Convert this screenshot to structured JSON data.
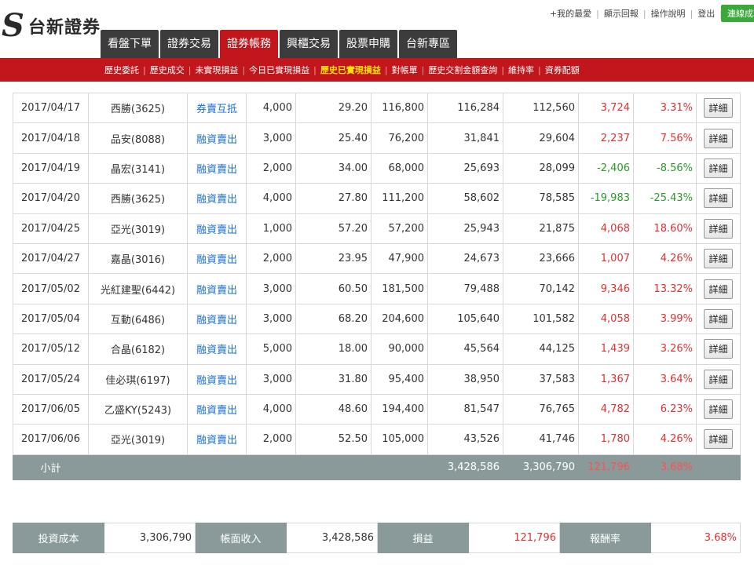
{
  "header": {
    "logo_text": "台新證券",
    "top_links": [
      "+我的最愛",
      "顯示回報",
      "操作說明",
      "登出"
    ],
    "login_button": "連線成功"
  },
  "main_tabs": [
    {
      "label": "看盤下單",
      "active": false
    },
    {
      "label": "證券交易",
      "active": false
    },
    {
      "label": "證券帳務",
      "active": true
    },
    {
      "label": "興櫃交易",
      "active": false
    },
    {
      "label": "股票申購",
      "active": false
    },
    {
      "label": "台新專區",
      "active": false
    }
  ],
  "sub_nav": [
    {
      "label": "歷史委託",
      "active": false
    },
    {
      "label": "歷史成交",
      "active": false
    },
    {
      "label": "未實現損益",
      "active": false
    },
    {
      "label": "今日已實現損益",
      "active": false
    },
    {
      "label": "歷史已實現損益",
      "active": true
    },
    {
      "label": "對帳單",
      "active": false
    },
    {
      "label": "歷史交割金額查詢",
      "active": false
    },
    {
      "label": "維持率",
      "active": false
    },
    {
      "label": "資券配額",
      "active": false
    }
  ],
  "detail_label": "詳細",
  "rows": [
    {
      "date": "2017/04/17",
      "stock": "西勝(3625)",
      "type": "券賣互抵",
      "qty": "4,000",
      "price": "29.20",
      "amount": "116,800",
      "income": "116,284",
      "cost": "112,560",
      "pnl": "3,724",
      "rate": "3.31%",
      "sign": "pos"
    },
    {
      "date": "2017/04/18",
      "stock": "品安(8088)",
      "type": "融資賣出",
      "qty": "3,000",
      "price": "25.40",
      "amount": "76,200",
      "income": "31,841",
      "cost": "29,604",
      "pnl": "2,237",
      "rate": "7.56%",
      "sign": "pos"
    },
    {
      "date": "2017/04/19",
      "stock": "晶宏(3141)",
      "type": "融資賣出",
      "qty": "2,000",
      "price": "34.00",
      "amount": "68,000",
      "income": "25,693",
      "cost": "28,099",
      "pnl": "-2,406",
      "rate": "-8.56%",
      "sign": "neg"
    },
    {
      "date": "2017/04/20",
      "stock": "西勝(3625)",
      "type": "融資賣出",
      "qty": "4,000",
      "price": "27.80",
      "amount": "111,200",
      "income": "58,602",
      "cost": "78,585",
      "pnl": "-19,983",
      "rate": "-25.43%",
      "sign": "neg"
    },
    {
      "date": "2017/04/25",
      "stock": "亞光(3019)",
      "type": "融資賣出",
      "qty": "1,000",
      "price": "57.20",
      "amount": "57,200",
      "income": "25,943",
      "cost": "21,875",
      "pnl": "4,068",
      "rate": "18.60%",
      "sign": "pos"
    },
    {
      "date": "2017/04/27",
      "stock": "嘉晶(3016)",
      "type": "融資賣出",
      "qty": "2,000",
      "price": "23.95",
      "amount": "47,900",
      "income": "24,673",
      "cost": "23,666",
      "pnl": "1,007",
      "rate": "4.26%",
      "sign": "pos"
    },
    {
      "date": "2017/05/02",
      "stock": "光紅建聖(6442)",
      "type": "融資賣出",
      "qty": "3,000",
      "price": "60.50",
      "amount": "181,500",
      "income": "79,488",
      "cost": "70,142",
      "pnl": "9,346",
      "rate": "13.32%",
      "sign": "pos"
    },
    {
      "date": "2017/05/04",
      "stock": "互動(6486)",
      "type": "融資賣出",
      "qty": "3,000",
      "price": "68.20",
      "amount": "204,600",
      "income": "105,640",
      "cost": "101,582",
      "pnl": "4,058",
      "rate": "3.99%",
      "sign": "pos"
    },
    {
      "date": "2017/05/12",
      "stock": "合晶(6182)",
      "type": "融資賣出",
      "qty": "5,000",
      "price": "18.00",
      "amount": "90,000",
      "income": "45,564",
      "cost": "44,125",
      "pnl": "1,439",
      "rate": "3.26%",
      "sign": "pos"
    },
    {
      "date": "2017/05/24",
      "stock": "佳必琪(6197)",
      "type": "融資賣出",
      "qty": "3,000",
      "price": "31.80",
      "amount": "95,400",
      "income": "38,950",
      "cost": "37,583",
      "pnl": "1,367",
      "rate": "3.64%",
      "sign": "pos"
    },
    {
      "date": "2017/06/05",
      "stock": "乙盛KY(5243)",
      "type": "融資賣出",
      "qty": "4,000",
      "price": "48.60",
      "amount": "194,400",
      "income": "81,547",
      "cost": "76,765",
      "pnl": "4,782",
      "rate": "6.23%",
      "sign": "pos"
    },
    {
      "date": "2017/06/06",
      "stock": "亞光(3019)",
      "type": "融資賣出",
      "qty": "2,000",
      "price": "52.50",
      "amount": "105,000",
      "income": "43,526",
      "cost": "41,746",
      "pnl": "1,780",
      "rate": "4.26%",
      "sign": "pos"
    }
  ],
  "subtotal": {
    "label": "小計",
    "income": "3,428,586",
    "cost": "3,306,790",
    "pnl": "121,796",
    "rate": "3.68%"
  },
  "summary": {
    "cost_label": "投資成本",
    "cost_value": "3,306,790",
    "income_label": "帳面收入",
    "income_value": "3,428,586",
    "pnl_label": "損益",
    "pnl_value": "121,796",
    "rate_label": "報酬率",
    "rate_value": "3.68%"
  },
  "colors": {
    "brand_red": "#c0161c",
    "profit": "#e03030",
    "loss": "#2a9a2a",
    "link": "#1a6fd0",
    "header_gray": "#8a9a9a"
  }
}
